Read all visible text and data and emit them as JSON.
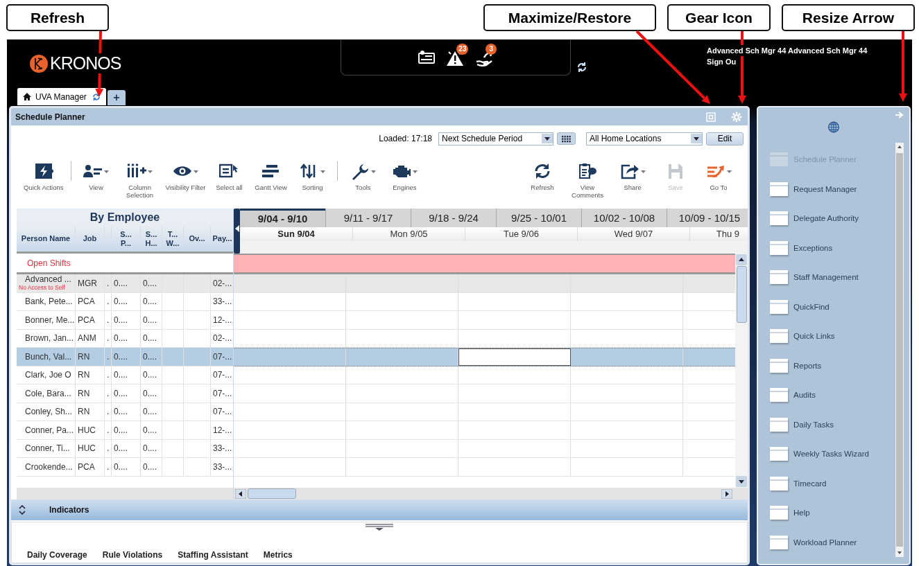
{
  "callouts": [
    {
      "label": "Refresh"
    },
    {
      "label": "Maximize/Restore"
    },
    {
      "label": "Gear Icon"
    },
    {
      "label": "Resize Arrow"
    }
  ],
  "header": {
    "logo": "KRONOS",
    "alerts": [
      {
        "badge": "23"
      },
      {
        "badge": "3"
      }
    ],
    "user": "Advanced Sch Mgr 44 Advanced Sch Mgr 44",
    "sign_out": "Sign Ou"
  },
  "tabs": [
    {
      "label": "UVA Manager",
      "selected": true
    }
  ],
  "add_tab": "+",
  "window": {
    "title": "Schedule Planner"
  },
  "loaded": "Loaded: 17:18",
  "period": {
    "value": "Next Schedule Period"
  },
  "locations": {
    "value": "All Home Locations"
  },
  "edit_button": "Edit",
  "toolbar": {
    "groups": [
      {
        "items": [
          {
            "label": "Quick Actions",
            "menu": false,
            "disabled": false
          }
        ]
      },
      {
        "items": [
          {
            "label": "View",
            "menu": true,
            "disabled": false
          },
          {
            "label": "Column Selection",
            "menu": true,
            "disabled": false
          },
          {
            "label": "Visibility Filter",
            "menu": true,
            "disabled": false
          },
          {
            "label": "Select all",
            "menu": false,
            "disabled": false
          },
          {
            "label": "Gantt View",
            "menu": false,
            "disabled": false
          },
          {
            "label": "Sorting",
            "menu": true,
            "disabled": false
          }
        ]
      },
      {
        "items": [
          {
            "label": "Tools",
            "menu": true,
            "disabled": false
          },
          {
            "label": "Engines",
            "menu": true,
            "disabled": false
          }
        ]
      }
    ],
    "right": [
      {
        "label": "Refresh",
        "menu": false,
        "disabled": false
      },
      {
        "label": "View Comments",
        "menu": false,
        "disabled": false
      },
      {
        "label": "Share",
        "menu": true,
        "disabled": false
      },
      {
        "label": "Save",
        "menu": false,
        "disabled": true
      },
      {
        "label": "Go To",
        "menu": true,
        "disabled": false
      }
    ]
  },
  "grid": {
    "title": "By Employee",
    "columns": [
      "Person Name",
      "Job",
      "",
      "S...\nP...",
      "S...\nH...",
      "T...\nW...",
      "Ov...",
      "Pay..."
    ],
    "open_shifts": "Open Shifts",
    "rows": [
      {
        "kind": "self",
        "selected": false,
        "note": "No Access to Self",
        "cells": [
          "Advanced ...",
          "MGR",
          ".",
          "0....",
          "0....",
          "",
          "",
          "02-..."
        ]
      },
      {
        "kind": "employee",
        "selected": false,
        "cells": [
          "Bank, Pete...",
          "PCA",
          ".",
          "0....",
          "0....",
          "",
          "",
          "33-..."
        ]
      },
      {
        "kind": "employee",
        "selected": false,
        "cells": [
          "Bonner, Me...",
          "PCA",
          ".",
          "0....",
          "0....",
          "",
          "",
          "12-..."
        ]
      },
      {
        "kind": "employee",
        "selected": false,
        "cells": [
          "Brown, Jan...",
          "ANM",
          ".",
          "0....",
          "0....",
          "",
          "",
          "02-..."
        ]
      },
      {
        "kind": "employee",
        "selected": true,
        "cells": [
          "Bunch, Val...",
          "RN",
          ".",
          "0....",
          "0....",
          "",
          "",
          "07-..."
        ]
      },
      {
        "kind": "employee",
        "selected": false,
        "cells": [
          "Clark, Joe O",
          "RN",
          ".",
          "0....",
          "0....",
          "",
          "",
          "07-..."
        ]
      },
      {
        "kind": "employee",
        "selected": false,
        "cells": [
          "Cole, Bara...",
          "RN",
          ".",
          "0....",
          "0....",
          "",
          "",
          "07-..."
        ]
      },
      {
        "kind": "employee",
        "selected": false,
        "cells": [
          "Conley, Sh...",
          "RN",
          ".",
          "0....",
          "0....",
          "",
          "",
          "07-..."
        ]
      },
      {
        "kind": "employee",
        "selected": false,
        "cells": [
          "Conner, Pa...",
          "HUC",
          ".",
          "0....",
          "0....",
          "",
          "",
          "12-..."
        ]
      },
      {
        "kind": "employee",
        "selected": false,
        "cells": [
          "Conner, Ti...",
          "HUC",
          ".",
          "0....",
          "0....",
          "",
          "",
          "33-..."
        ]
      },
      {
        "kind": "employee",
        "selected": false,
        "cells": [
          "Crookende...",
          "PCA",
          ".",
          "0....",
          "0....",
          "",
          "",
          "33-..."
        ]
      }
    ]
  },
  "gantt": {
    "weeks": [
      {
        "label": "9/04 - 9/10",
        "selected": true
      },
      {
        "label": "9/11 - 9/17",
        "selected": false
      },
      {
        "label": "9/18 - 9/24",
        "selected": false
      },
      {
        "label": "9/25 - 10/01",
        "selected": false
      },
      {
        "label": "10/02 - 10/08",
        "selected": false
      },
      {
        "label": "10/09 - 10/15",
        "selected": false
      }
    ],
    "days": [
      {
        "label": "Sun 9/04",
        "selected": true,
        "cursor": false
      },
      {
        "label": "Mon 9/05",
        "selected": false,
        "cursor": false
      },
      {
        "label": "Tue 9/06",
        "selected": false,
        "cursor": true
      },
      {
        "label": "Wed 9/07",
        "selected": false,
        "cursor": false
      },
      {
        "label": "Thu 9",
        "selected": false,
        "cursor": false
      }
    ]
  },
  "indicators": {
    "title": "Indicators",
    "tabs": [
      "Daily Coverage",
      "Rule Violations",
      "Staffing Assistant",
      "Metrics"
    ]
  },
  "sidebar": {
    "items": [
      {
        "label": "Schedule Planner",
        "disabled": true
      },
      {
        "label": "Request Manager",
        "disabled": false
      },
      {
        "label": "Delegate Authority",
        "disabled": false
      },
      {
        "label": "Exceptions",
        "disabled": false
      },
      {
        "label": "Staff Management",
        "disabled": false
      },
      {
        "label": "QuickFind",
        "disabled": false
      },
      {
        "label": "Quick Links",
        "disabled": false
      },
      {
        "label": "Reports",
        "disabled": false
      },
      {
        "label": "Audits",
        "disabled": false
      },
      {
        "label": "Daily Tasks",
        "disabled": false
      },
      {
        "label": "Weekly Tasks Wizard",
        "disabled": false
      },
      {
        "label": "Timecard",
        "disabled": false
      },
      {
        "label": "Help",
        "disabled": false
      },
      {
        "label": "Workload Planner",
        "disabled": false
      }
    ]
  }
}
